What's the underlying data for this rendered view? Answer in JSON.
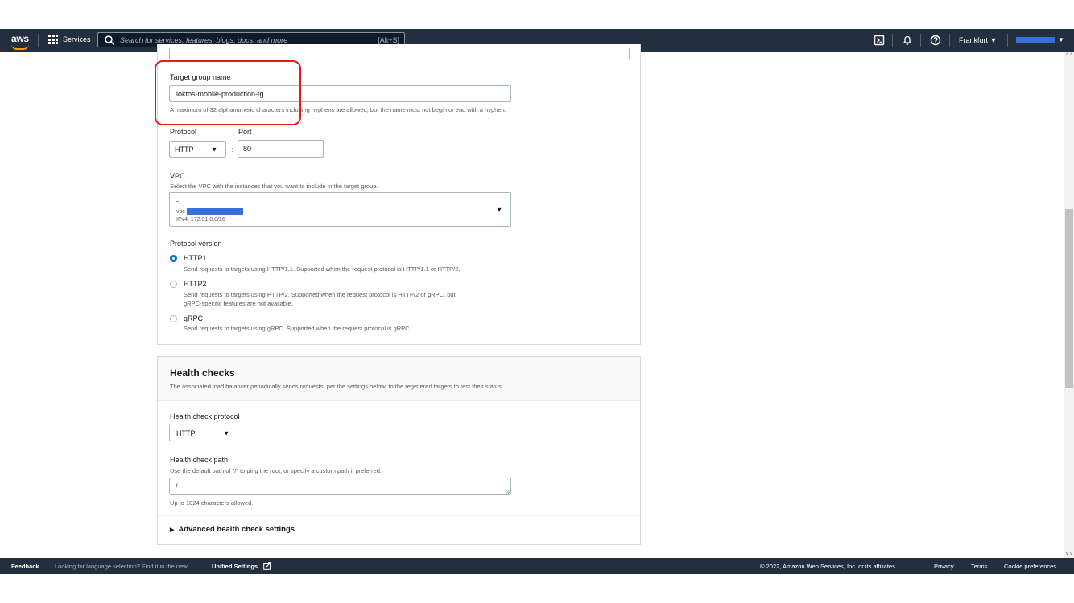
{
  "topnav": {
    "logo": "aws",
    "services_label": "Services",
    "search_placeholder": "Search for services, features, blogs, docs, and more",
    "search_shortcut": "[Alt+S]",
    "region": "Frankfurt",
    "icons": [
      "cloudshell-icon",
      "bell-icon",
      "help-icon"
    ]
  },
  "target_group": {
    "name_label": "Target group name",
    "name_value": "loktos-mobile-production-tg",
    "name_hint": "A maximum of 32 alphanumeric characters including hyphens are allowed, but the name must not begin or end with a hyphen.",
    "protocol_label": "Protocol",
    "protocol_value": "HTTP",
    "port_label": "Port",
    "port_value": "80",
    "port_separator": ":"
  },
  "vpc": {
    "label": "VPC",
    "description": "Select the VPC with the instances that you want to include in the target group.",
    "selected_name": "-",
    "selected_id_prefix": "vpc-",
    "selected_cidr": "IPv4: 172.31.0.0/16"
  },
  "protocol_version": {
    "label": "Protocol version",
    "options": [
      {
        "label": "HTTP1",
        "description": "Send requests to targets using HTTP/1.1. Supported when the request protocol is HTTP/1.1 or HTTP/2.",
        "selected": true
      },
      {
        "label": "HTTP2",
        "description": "Send requests to targets using HTTP/2. Supported when the request protocol is HTTP/2 or gRPC, but",
        "description2": "gRPC-specific features are not available.",
        "selected": false
      },
      {
        "label": "gRPC",
        "description": "Send requests to targets using gRPC. Supported when the request protocol is gRPC.",
        "selected": false
      }
    ]
  },
  "health_checks": {
    "title": "Health checks",
    "description": "The associated load balancer periodically sends requests, per the settings below, to the registered targets to test their status.",
    "protocol_label": "Health check protocol",
    "protocol_value": "HTTP",
    "path_label": "Health check path",
    "path_description": "Use the default path of \"/\" to ping the root, or specify a custom path if preferred.",
    "path_value": "/",
    "path_hint": "Up to 1024 characters allowed.",
    "advanced_label": "Advanced health check settings"
  },
  "footer": {
    "feedback": "Feedback",
    "language_text": "Looking for language selection? Find it in the new",
    "unified_settings": "Unified Settings",
    "copyright": "© 2022, Amazon Web Services, Inc. or its affiliates.",
    "privacy": "Privacy",
    "terms": "Terms",
    "cookie": "Cookie preferences"
  }
}
